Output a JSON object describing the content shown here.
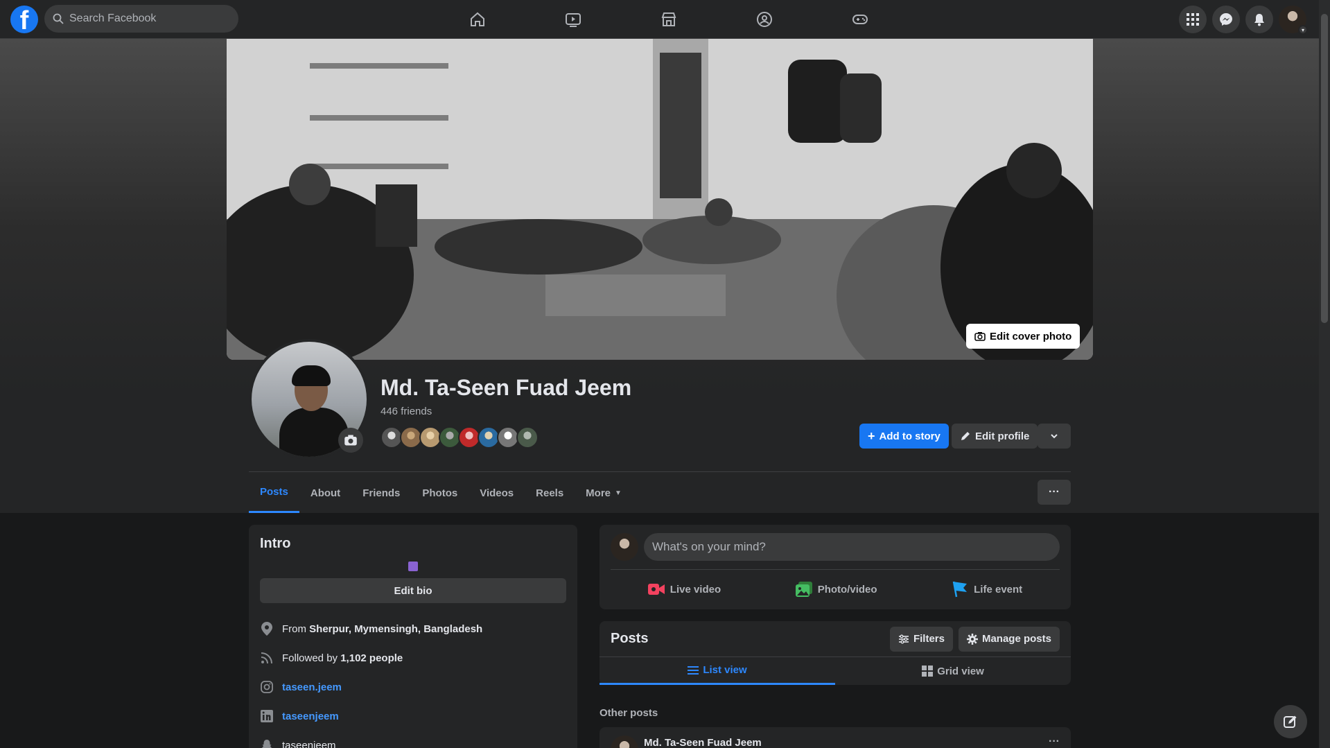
{
  "search": {
    "placeholder": "Search Facebook"
  },
  "profile": {
    "name": "Md. Ta-Seen Fuad Jeem",
    "friends_count": "446 friends",
    "edit_cover_label": "Edit cover photo",
    "add_story_label": "Add to story",
    "edit_profile_label": "Edit profile"
  },
  "tabs": [
    "Posts",
    "About",
    "Friends",
    "Photos",
    "Videos",
    "Reels",
    "More"
  ],
  "intro": {
    "title": "Intro",
    "edit_bio_label": "Edit bio",
    "from_prefix": "From ",
    "from_value": "Sherpur, Mymensingh, Bangladesh",
    "followed_prefix": "Followed by ",
    "followed_value": "1,102 people",
    "instagram": "taseen.jeem",
    "linkedin": "taseenjeem",
    "snapchat": "taseenjeem"
  },
  "composer": {
    "placeholder": "What's on your mind?",
    "live_video": "Live video",
    "photo_video": "Photo/video",
    "life_event": "Life event"
  },
  "posts": {
    "title": "Posts",
    "filters_label": "Filters",
    "manage_label": "Manage posts",
    "list_view": "List view",
    "grid_view": "Grid view",
    "other_posts": "Other posts",
    "author": "Md. Ta-Seen Fuad Jeem"
  },
  "colors": {
    "brand": "#1877f2",
    "accent_link": "#2d88ff",
    "background": "#18191a",
    "surface": "#242526"
  }
}
